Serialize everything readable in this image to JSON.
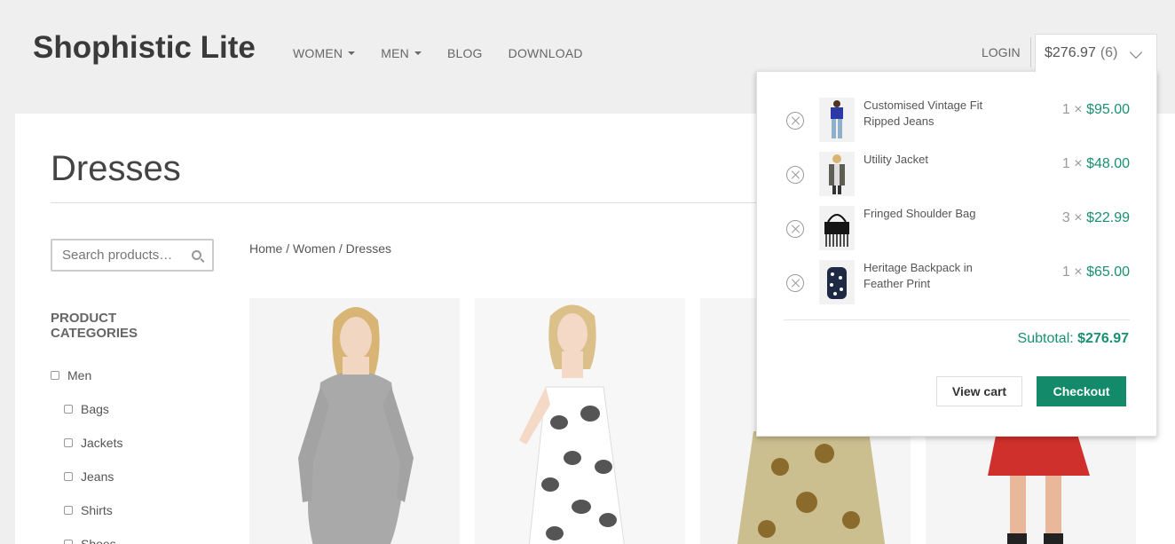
{
  "site": {
    "title": "Shophistic Lite"
  },
  "nav": {
    "items": [
      {
        "label": "WOMEN",
        "dropdown": true
      },
      {
        "label": "MEN",
        "dropdown": true
      },
      {
        "label": "BLOG",
        "dropdown": false
      },
      {
        "label": "DOWNLOAD",
        "dropdown": false
      }
    ],
    "login_label": "LOGIN"
  },
  "cart": {
    "total": "$276.97",
    "count": "(6)",
    "items": [
      {
        "name": "Customised Vintage Fit Ripped Jeans",
        "qty": "1 ×",
        "price": "$95.00"
      },
      {
        "name": "Utility Jacket",
        "qty": "1 ×",
        "price": "$48.00"
      },
      {
        "name": "Fringed Shoulder Bag",
        "qty": "3 ×",
        "price": "$22.99"
      },
      {
        "name": "Heritage Backpack in Feather Print",
        "qty": "1 ×",
        "price": "$65.00"
      }
    ],
    "subtotal_label": "Subtotal:",
    "subtotal_value": "$276.97",
    "view_cart_label": "View cart",
    "checkout_label": "Checkout"
  },
  "page": {
    "title": "Dresses",
    "search_placeholder": "Search products…",
    "breadcrumb": "Home / Women / Dresses"
  },
  "categories": {
    "heading": "PRODUCT CATEGORIES",
    "items": [
      {
        "label": "Men",
        "sub": false
      },
      {
        "label": "Bags",
        "sub": true
      },
      {
        "label": "Jackets",
        "sub": true
      },
      {
        "label": "Jeans",
        "sub": true
      },
      {
        "label": "Shirts",
        "sub": true
      },
      {
        "label": "Shoes",
        "sub": true
      }
    ]
  },
  "colors": {
    "accent": "#138b6a",
    "price": "#1a9070"
  }
}
